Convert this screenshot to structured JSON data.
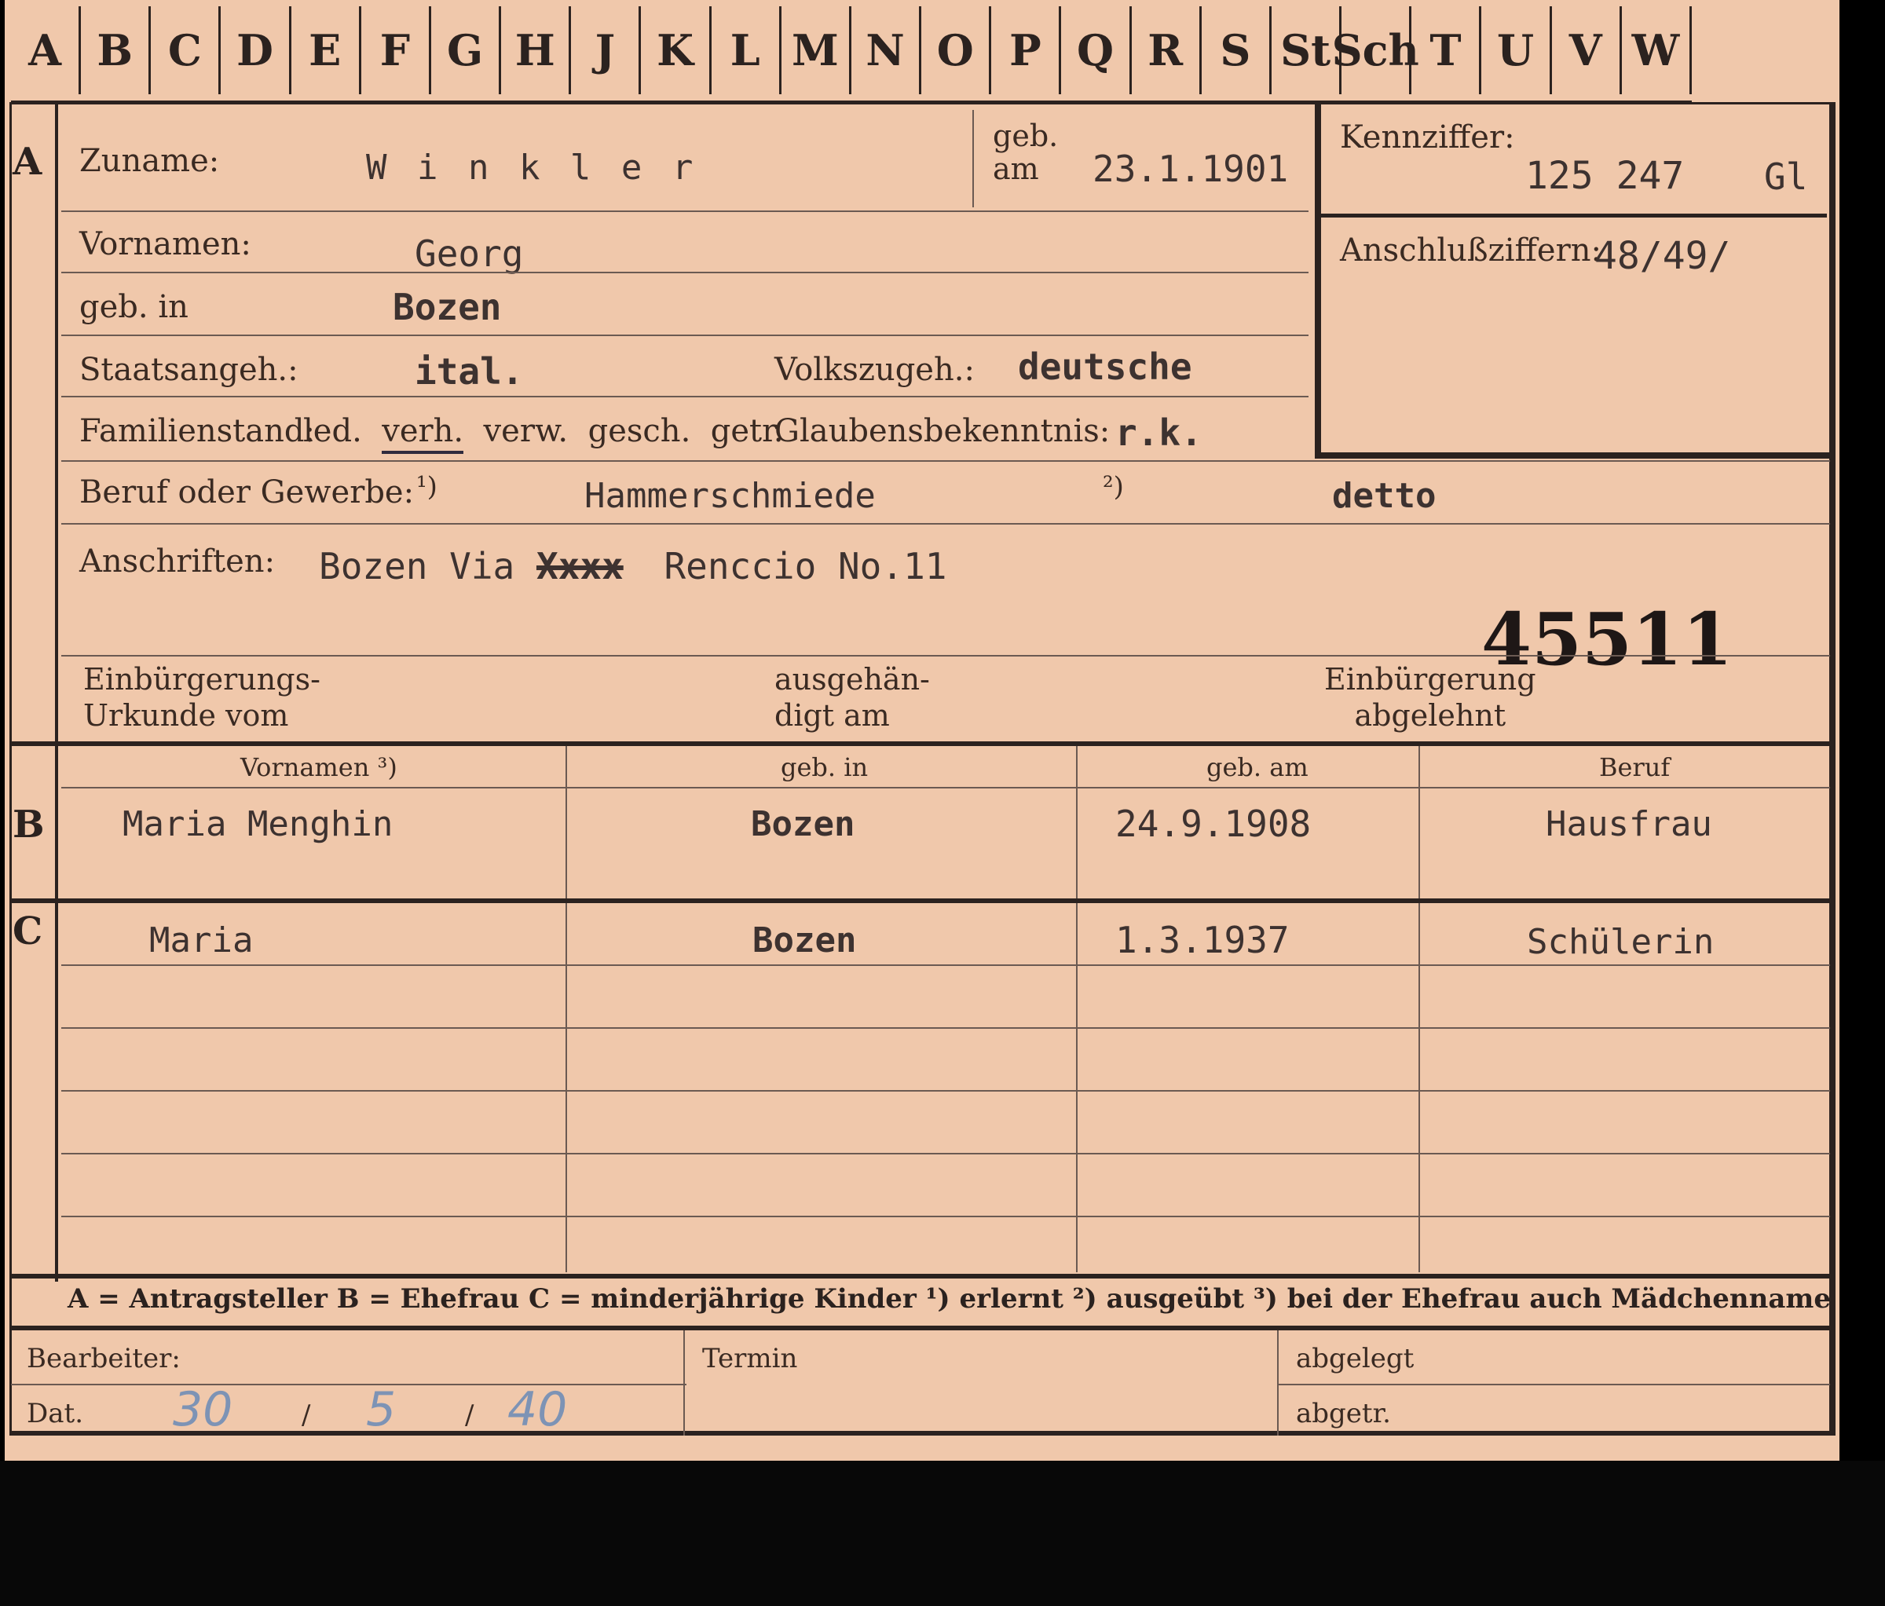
{
  "alphabet_tabs": [
    "A",
    "B",
    "C",
    "D",
    "E",
    "F",
    "G",
    "H",
    "J",
    "K",
    "L",
    "M",
    "N",
    "O",
    "P",
    "Q",
    "R",
    "S",
    "St",
    "Sch",
    "T",
    "U",
    "V",
    "W"
  ],
  "section_letters": {
    "a": "A",
    "b": "B",
    "c": "C"
  },
  "fields": {
    "zuname_label": "Zuname:",
    "zuname_value": "W i n k l e r",
    "geb_am_label": "geb.\nam",
    "geb_am_value": "23.1.1901",
    "kennziffer_label": "Kennziffer:",
    "kennziffer_value": "125 247",
    "kennziffer_suffix": "Gl",
    "anschluss_label": "Anschlußziffern:",
    "anschluss_value": "48/49/",
    "vornamen_label": "Vornamen:",
    "vornamen_value": "Georg",
    "geb_in_label": "geb. in",
    "geb_in_value": "Bozen",
    "staatsangeh_label": "Staatsangeh.:",
    "staatsangeh_value": "ital.",
    "volkszugeh_label": "Volkszugeh.:",
    "volkszugeh_value": "deutsche",
    "familienstand_label": "Familienstand:",
    "familienstand_options": [
      "led.",
      "verh.",
      "verw.",
      "gesch.",
      "getr."
    ],
    "familienstand_selected": "verh.",
    "glauben_label": "Glaubensbekenntnis:",
    "glauben_value": "r.k.",
    "beruf_label": "Beruf oder Gewerbe:",
    "beruf_note1": "¹)",
    "beruf_value1": "Hammerschmiede",
    "beruf_note2": "²)",
    "beruf_value2": "detto",
    "anschriften_label": "Anschriften:",
    "anschriften_prefix": "Bozen Via",
    "anschriften_struck": "Xxxx",
    "anschriften_rest": "Renccio No.11",
    "big_number": "45511",
    "einbuergerung_urkunde_label": "Einbürgerungs-\nUrkunde vom",
    "ausgehaendigt_label": "ausgehän-\ndigt am",
    "einbuergerung_abgelehnt_label": "Einbürgerung\nabgelehnt"
  },
  "family_table": {
    "headers": [
      "Vornamen ³)",
      "geb. in",
      "geb. am",
      "Beruf"
    ],
    "spouse": [
      "Maria Menghin",
      "Bozen",
      "24.9.1908",
      "Hausfrau"
    ],
    "children": [
      [
        "Maria",
        "Bozen",
        "1.3.1937",
        "Schülerin"
      ]
    ]
  },
  "legend": "A = Antragsteller   B = Ehefrau   C = minderjährige Kinder   ¹) erlernt   ²) ausgeübt   ³) bei der Ehefrau auch Mädchenname",
  "footer": {
    "bearbeiter_label": "Bearbeiter:",
    "dat_label": "Dat.",
    "dat_value": [
      "30",
      "5",
      "40"
    ],
    "termin_label": "Termin",
    "abgelegt_label": "abgelegt",
    "abgetr_label": "abgetr."
  }
}
